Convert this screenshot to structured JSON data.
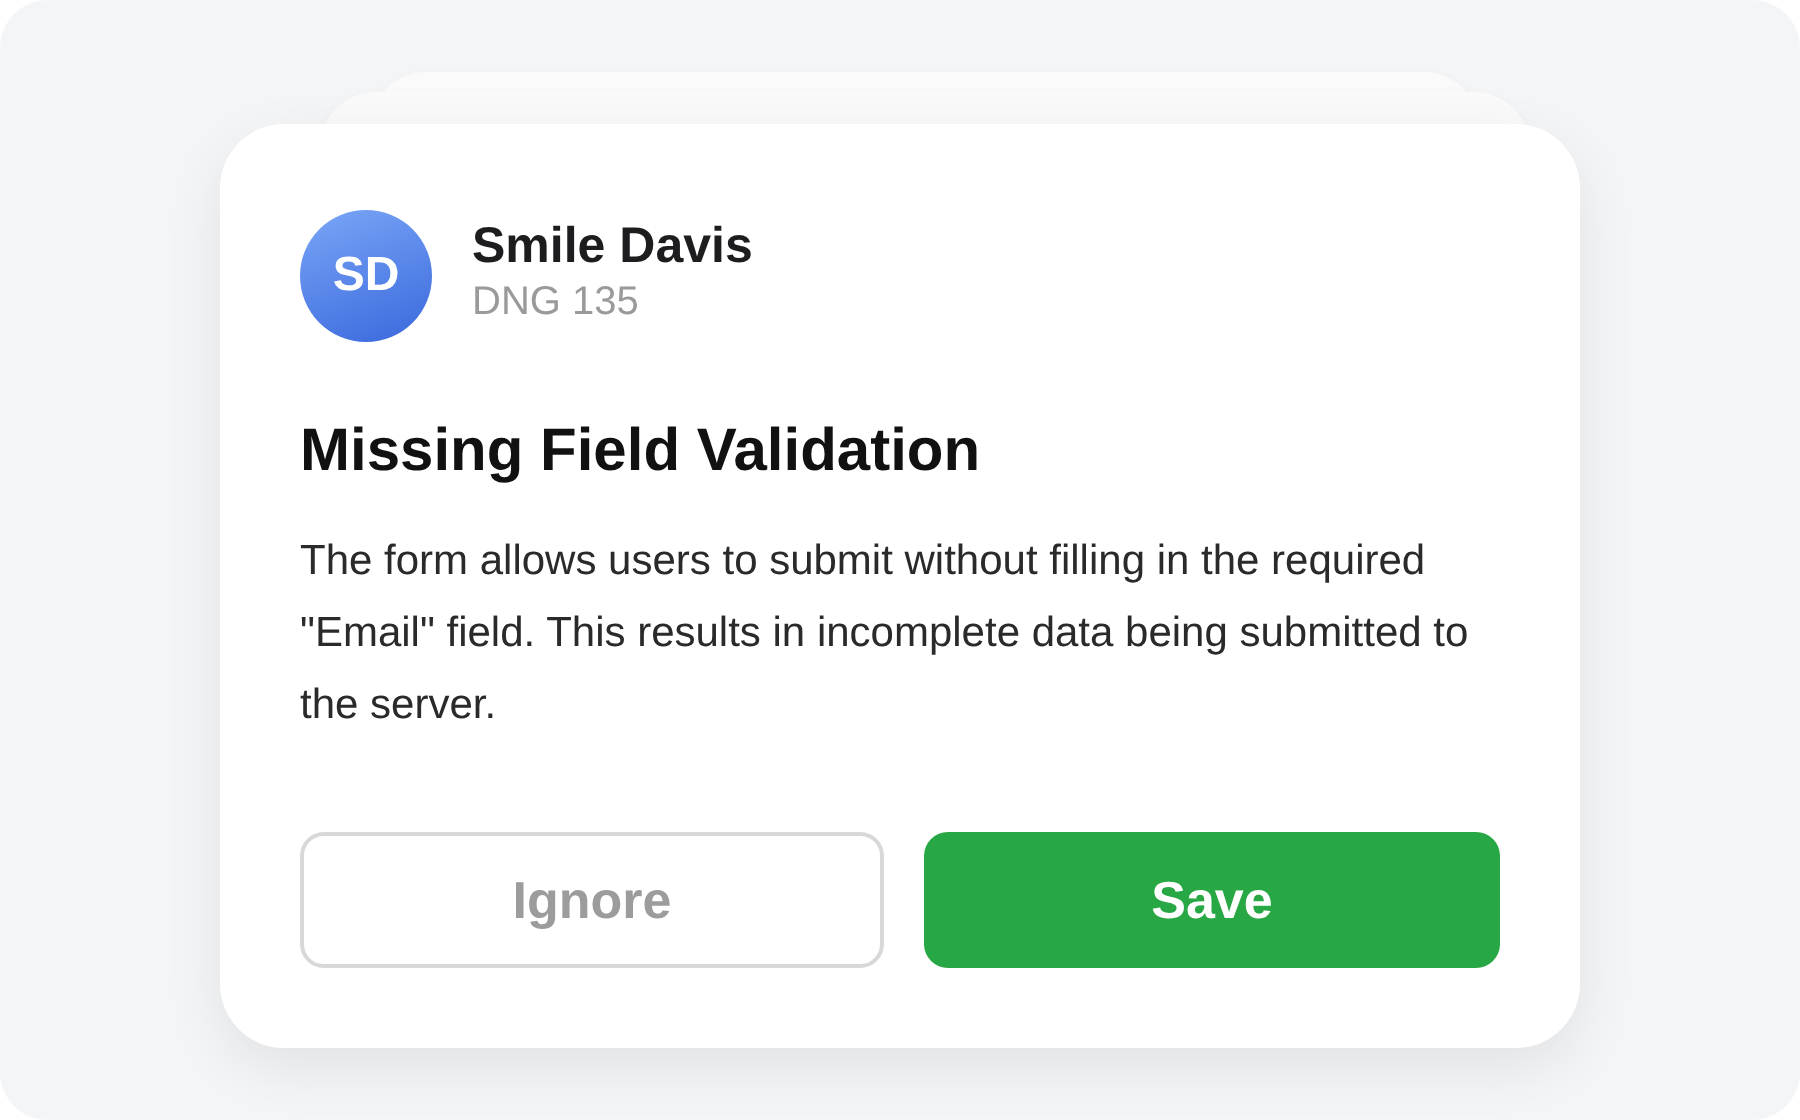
{
  "user": {
    "initials": "SD",
    "name": "Smile Davis",
    "code": "DNG 135"
  },
  "issue": {
    "title": "Missing Field Validation",
    "description": "The form allows users to submit without filling in the required \"Email\" field. This results in incomplete data being submitted to the server."
  },
  "buttons": [
    {
      "label": "Ignore",
      "kind": "secondary"
    },
    {
      "label": "Save",
      "kind": "primary"
    }
  ]
}
